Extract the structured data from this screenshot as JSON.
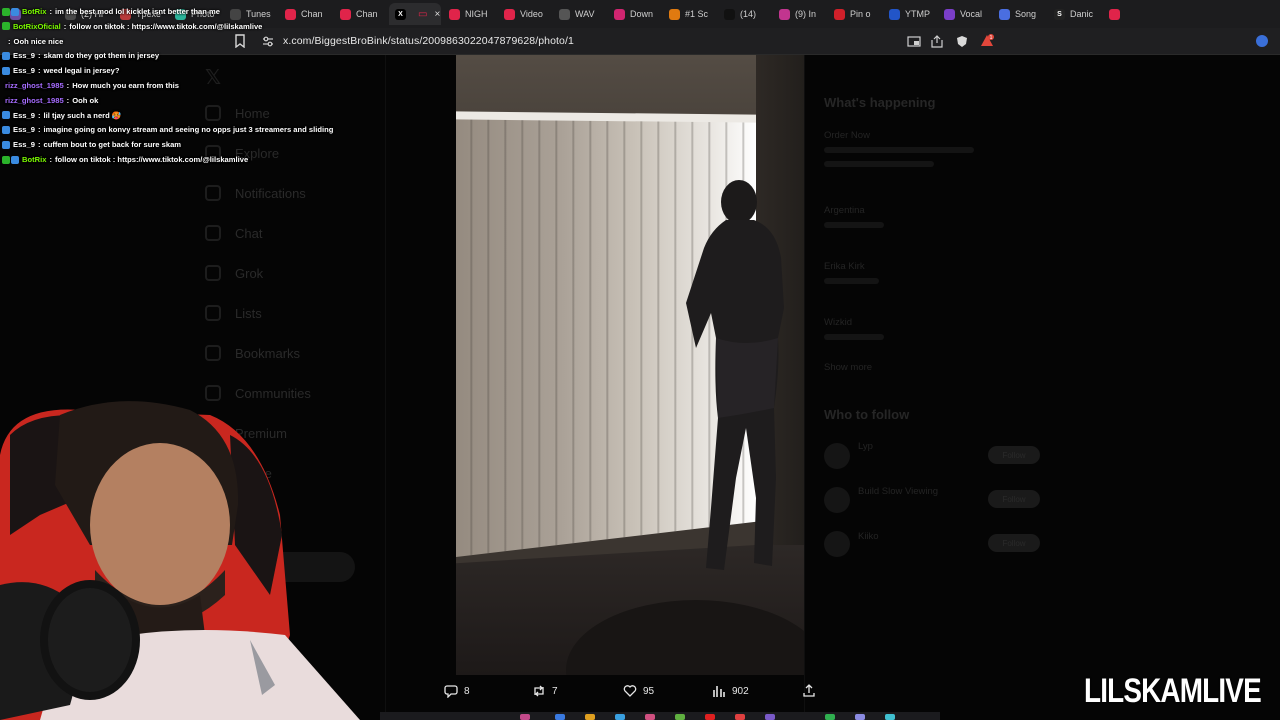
{
  "browser": {
    "tabs": [
      {
        "label": "",
        "favicon": "#6b4ea3",
        "glyph": ""
      },
      {
        "label": "(2) Hi",
        "favicon": "#4a4a4a",
        "glyph": ""
      },
      {
        "label": "Tpexe",
        "favicon": "#b83a3a",
        "glyph": ""
      },
      {
        "label": "Photo",
        "favicon": "#2bb39a",
        "glyph": ""
      },
      {
        "label": "Tunes",
        "favicon": "#444444",
        "glyph": ""
      },
      {
        "label": "Chan",
        "favicon": "#e0244a",
        "glyph": ""
      },
      {
        "label": "Chan",
        "favicon": "#e0244a",
        "glyph": ""
      },
      {
        "label": "",
        "favicon": "#000000",
        "glyph": "X",
        "active": true
      },
      {
        "label": "NIGH",
        "favicon": "#e0244a",
        "glyph": ""
      },
      {
        "label": "Video",
        "favicon": "#e0244a",
        "glyph": ""
      },
      {
        "label": "WAV",
        "favicon": "#555555",
        "glyph": ""
      },
      {
        "label": "Down",
        "favicon": "#d02570",
        "glyph": ""
      },
      {
        "label": "#1 Sc",
        "favicon": "#e07a10",
        "glyph": ""
      },
      {
        "label": "(14)",
        "favicon": "#111111",
        "glyph": ""
      },
      {
        "label": "(9) In",
        "favicon": "#c2358f",
        "glyph": ""
      },
      {
        "label": "Pin o",
        "favicon": "#d0202a",
        "glyph": ""
      },
      {
        "label": "YTMP",
        "favicon": "#2255c8",
        "glyph": ""
      },
      {
        "label": "Vocal",
        "favicon": "#7a3ec8",
        "glyph": ""
      },
      {
        "label": "Song",
        "favicon": "#4a6ee0",
        "glyph": ""
      },
      {
        "label": "Danic",
        "favicon": "#222222",
        "glyph": "S"
      },
      {
        "label": "",
        "favicon": "#e0244a",
        "glyph": ""
      }
    ],
    "url": "x.com/BiggestBroBink/status/2009863022047879628/photo/1",
    "brave_badge_count": "1"
  },
  "x_page_dimmed": {
    "nav": [
      "Home",
      "Explore",
      "Notifications",
      "Chat",
      "Grok",
      "Lists",
      "Bookmarks",
      "Communities",
      "Premium",
      "Profile"
    ],
    "right": {
      "whats_happening": "What's happening",
      "trend_1": "Order Now",
      "trend_2": "Argentina",
      "trend_3": "Erika Kirk",
      "trend_4": "Wizkid",
      "show_more": "Show more",
      "who_to_follow": "Who to follow",
      "follow_1": "Lyp",
      "follow_2": "Build Slow Viewing",
      "follow_3": "Kiiko",
      "follow_label": "Follow"
    }
  },
  "post_actions": {
    "replies": "8",
    "reposts": "7",
    "likes": "95",
    "views": "902"
  },
  "chat": [
    {
      "user": "BotRix",
      "color": "#7cfc00",
      "badges": [
        "#2bb32b",
        "#3a8be0"
      ],
      "msg": "im the best mod lol kicklet isnt better than me"
    },
    {
      "user": "BotRixOficial",
      "color": "#7cfc00",
      "badges": [
        "#2bb32b"
      ],
      "msg": "follow on tiktok : https://www.tiktok.com/@lilskamlive"
    },
    {
      "user": "",
      "color": "#a66cff",
      "badges": [],
      "msg": "Ooh nice nice"
    },
    {
      "user": "Ess_9",
      "color": "#ffffff",
      "badges": [
        "#3a8be0"
      ],
      "msg": "skam do they got them in jersey"
    },
    {
      "user": "Ess_9",
      "color": "#ffffff",
      "badges": [
        "#3a8be0"
      ],
      "msg": "weed legal in jersey?"
    },
    {
      "user": "rizz_ghost_1985",
      "color": "#a66cff",
      "badges": [],
      "msg": "How much you earn from this"
    },
    {
      "user": "rizz_ghost_1985",
      "color": "#a66cff",
      "badges": [],
      "msg": "Ooh ok"
    },
    {
      "user": "Ess_9",
      "color": "#ffffff",
      "badges": [
        "#3a8be0"
      ],
      "msg": "lil tjay such a nerd 🥵"
    },
    {
      "user": "Ess_9",
      "color": "#ffffff",
      "badges": [
        "#3a8be0"
      ],
      "msg": "imagine going on konvy stream and seeing no opps just 3 streamers and sliding"
    },
    {
      "user": "Ess_9",
      "color": "#ffffff",
      "badges": [
        "#3a8be0"
      ],
      "msg": "cuffem bout to get back for sure skam"
    },
    {
      "user": "BotRix",
      "color": "#7cfc00",
      "badges": [
        "#2bb32b",
        "#3a8be0"
      ],
      "msg": "follow on tiktok : https://www.tiktok.com/@lilskamlive"
    }
  ],
  "stream": {
    "logo_text": "LILSKAMLIVE"
  },
  "icons": {
    "reply": "reply-icon",
    "repost": "repost-icon",
    "like": "heart-icon",
    "views": "views-icon",
    "share": "share-icon"
  }
}
